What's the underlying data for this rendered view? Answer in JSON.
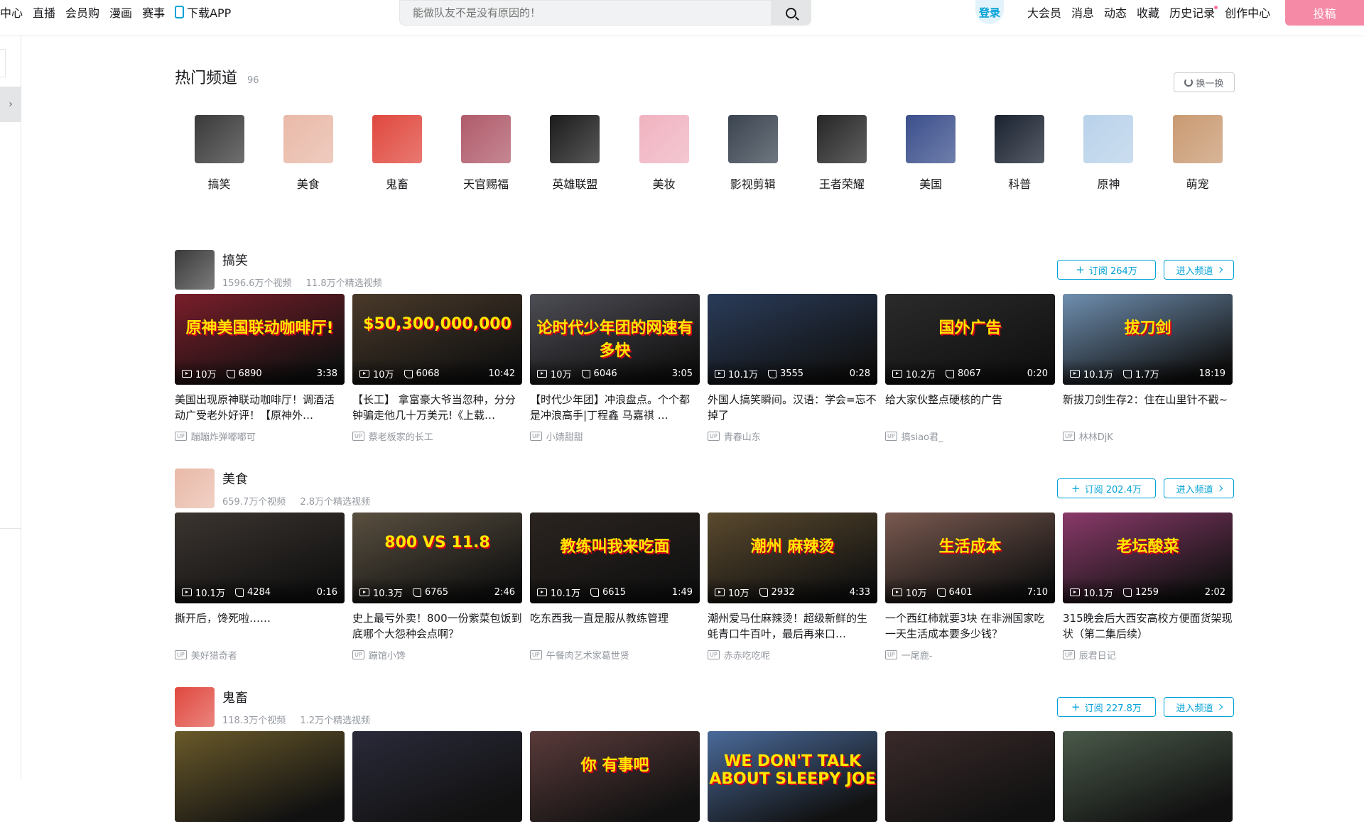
{
  "nav": {
    "left": [
      "中心",
      "直播",
      "会员购",
      "漫画",
      "赛事"
    ],
    "app": "下载APP",
    "search_placeholder": "能做队友不是没有原因的！",
    "login": "登录",
    "right": [
      "大会员",
      "消息",
      "动态",
      "收藏",
      "历史记录",
      "创作中心"
    ],
    "upload": "投稿"
  },
  "hot": {
    "title": "热门频道",
    "count": "96",
    "swap": "换一换",
    "channels": [
      {
        "name": "搞笑",
        "color": "#3a3a3a"
      },
      {
        "name": "美食",
        "color": "#e9b9a8"
      },
      {
        "name": "鬼畜",
        "color": "#e0483e"
      },
      {
        "name": "天官赐福",
        "color": "#b05b6b"
      },
      {
        "name": "英雄联盟",
        "color": "#1b1b1b"
      },
      {
        "name": "美妆",
        "color": "#f0b3c0"
      },
      {
        "name": "影视剪辑",
        "color": "#3a4450"
      },
      {
        "name": "王者荣耀",
        "color": "#262626"
      },
      {
        "name": "美国",
        "color": "#3b4f8c"
      },
      {
        "name": "科普",
        "color": "#1a2230"
      },
      {
        "name": "原神",
        "color": "#b9d2ea"
      },
      {
        "name": "萌宠",
        "color": "#c99a72"
      }
    ]
  },
  "sections": [
    {
      "name": "搞笑",
      "videos_count": "1596.6万个视频",
      "featured_count": "11.8万个精选视频",
      "subscribe": "订阅 264万",
      "enter": "进入频道",
      "avatar_color": "#3a3a3a",
      "videos": [
        {
          "title": "美国出现原神联动咖啡厅！调酒活动广受老外好评！【原神外…",
          "up": "蹦蹦炸弹嘟嘟可",
          "views": "10万",
          "likes": "6890",
          "dur": "3:38",
          "color": "#7a1e2a",
          "overlay": "原神美国联动咖啡厅!"
        },
        {
          "title": "【长工】 拿富豪大爷当忽种，分分钟骗走他几十万美元!《上载…",
          "up": "蔡老板家的长工",
          "views": "10万",
          "likes": "6068",
          "dur": "10:42",
          "color": "#4a3a2a",
          "overlay": "$50,300,000,000"
        },
        {
          "title": "【时代少年团】冲浪盘点。个个都是冲浪高手|丁程鑫 马嘉祺 …",
          "up": "小婧甜甜",
          "views": "10万",
          "likes": "6046",
          "dur": "3:05",
          "color": "#4d4d55",
          "overlay": "论时代少年团的网速有多快"
        },
        {
          "title": "外国人搞笑瞬间。汉语：学会=忘不掉了",
          "up": "青春山东",
          "views": "10.1万",
          "likes": "3555",
          "dur": "0:28",
          "color": "#2a3c5a",
          "overlay": ""
        },
        {
          "title": "给大家伙整点硬核的广告",
          "up": "搞siao君_",
          "views": "10.2万",
          "likes": "8067",
          "dur": "0:20",
          "color": "#2b2b2b",
          "overlay": "国外广告"
        },
        {
          "title": "新拔刀剑生存2：住在山里针不戳~",
          "up": "林林DjK",
          "views": "10.1万",
          "likes": "1.7万",
          "dur": "18:19",
          "color": "#6f8fb0",
          "overlay": "拔刀剑"
        }
      ]
    },
    {
      "name": "美食",
      "videos_count": "659.7万个视频",
      "featured_count": "2.8万个精选视频",
      "subscribe": "订阅 202.4万",
      "enter": "进入频道",
      "avatar_color": "#e9b9a8",
      "videos": [
        {
          "title": "撕开后，馋死啦……",
          "up": "美好猎奇者",
          "views": "10.1万",
          "likes": "4284",
          "dur": "0:16",
          "color": "#3c3530",
          "overlay": ""
        },
        {
          "title": "史上最亏外卖！800一份紫菜包饭到底哪个大怨种会点啊？",
          "up": "蹦馆小馋",
          "views": "10.3万",
          "likes": "6765",
          "dur": "2:46",
          "color": "#5a5040",
          "overlay": "800 VS 11.8"
        },
        {
          "title": "吃东西我一直是服从教练管理",
          "up": "午餐肉艺术家葛世贤",
          "views": "10.1万",
          "likes": "6615",
          "dur": "1:49",
          "color": "#2b2420",
          "overlay": "教练叫我来吃面"
        },
        {
          "title": "潮州爱马仕麻辣烫！超级新鲜的生蚝青口牛百叶，最后再来口…",
          "up": "赤赤吃吃呢",
          "views": "10万",
          "likes": "2932",
          "dur": "4:33",
          "color": "#5b4a2e",
          "overlay": "潮州 麻辣烫"
        },
        {
          "title": "一个西红柿就要3块 在非洲国家吃一天生活成本要多少钱？",
          "up": "一尾鹿-",
          "views": "10万",
          "likes": "6401",
          "dur": "7:10",
          "color": "#7a5a50",
          "overlay": "生活成本"
        },
        {
          "title": "315晚会后大西安高校方便面货架现状（第二集后续）",
          "up": "辰君日记",
          "views": "10.1万",
          "likes": "1259",
          "dur": "2:02",
          "color": "#8a3a6a",
          "overlay": "老坛酸菜"
        }
      ]
    },
    {
      "name": "鬼畜",
      "videos_count": "118.3万个视频",
      "featured_count": "1.2万个精选视频",
      "subscribe": "订阅 227.8万",
      "enter": "进入频道",
      "avatar_color": "#e0483e",
      "videos": [
        {
          "color": "#6a5a2a",
          "overlay": ""
        },
        {
          "color": "#2a2a3a",
          "overlay": ""
        },
        {
          "color": "#5a3a3a",
          "overlay": "你 有事吧"
        },
        {
          "color": "#4a6a9a",
          "overlay": "WE DON'T TALK ABOUT SLEEPY JOE"
        },
        {
          "color": "#3a2a2a",
          "overlay": ""
        },
        {
          "color": "#4a5a4a",
          "overlay": ""
        }
      ]
    }
  ]
}
